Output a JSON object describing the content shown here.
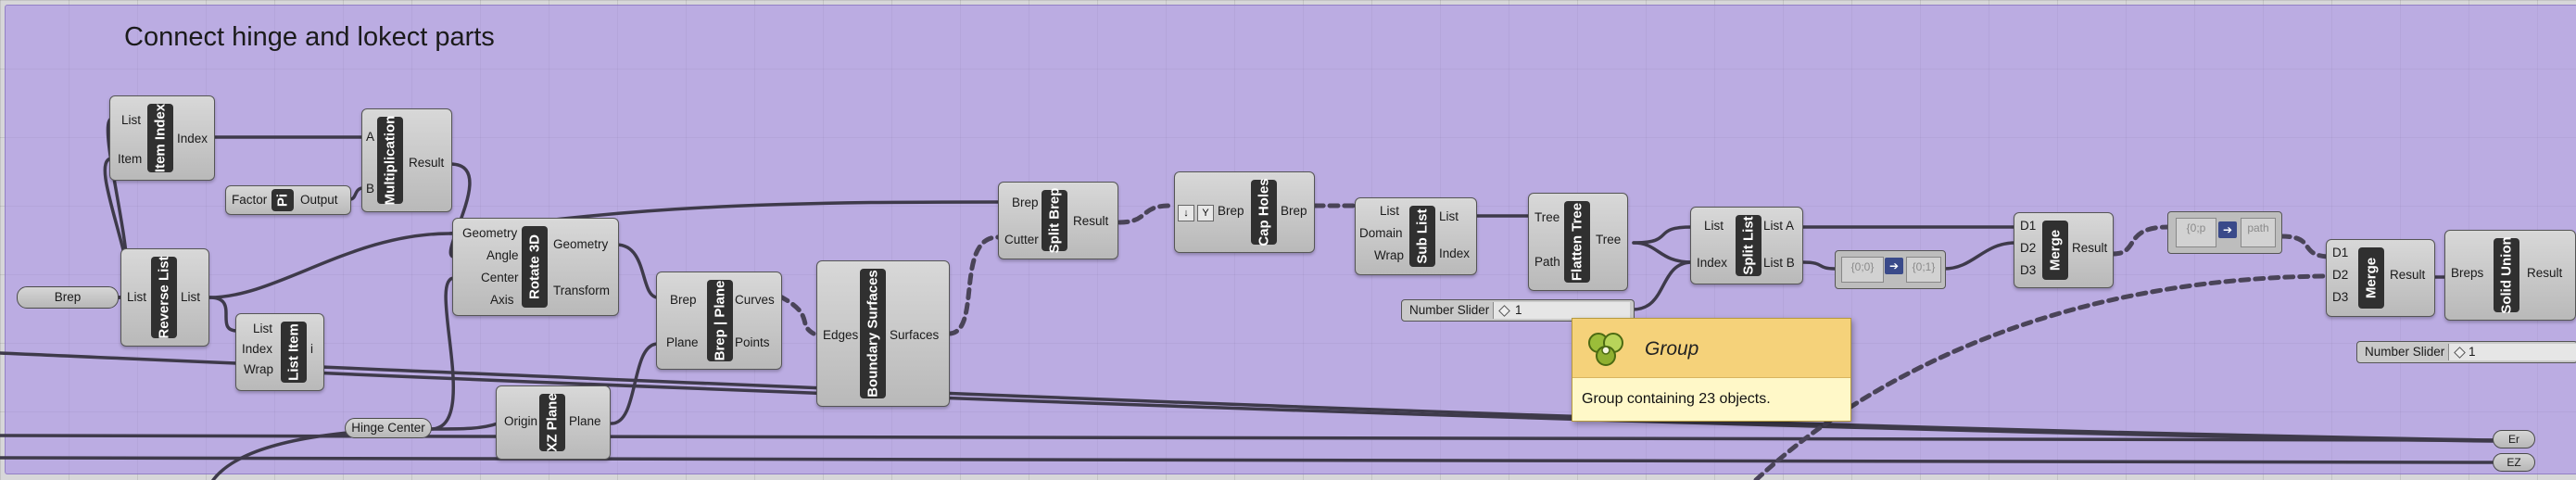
{
  "group": {
    "title": "Connect hinge and lokect parts"
  },
  "components": {
    "item_index": {
      "name": "Item Index",
      "inputs": [
        "List",
        "Item"
      ],
      "outputs": [
        "Index"
      ]
    },
    "multiplication": {
      "name": "Multiplication",
      "inputs": [
        "A",
        "B"
      ],
      "outputs": [
        "Result"
      ]
    },
    "pi": {
      "name": "Pi",
      "inputs": [
        "Factor"
      ],
      "outputs": [
        "Output"
      ]
    },
    "reverse_list": {
      "name": "Reverse List",
      "inputs": [
        "List"
      ],
      "outputs": [
        "List"
      ]
    },
    "list_item": {
      "name": "List Item",
      "inputs": [
        "List",
        "Index",
        "Wrap"
      ],
      "outputs": [
        "i"
      ]
    },
    "rotate_3d": {
      "name": "Rotate 3D",
      "inputs": [
        "Geometry",
        "Angle",
        "Center",
        "Axis"
      ],
      "outputs": [
        "Geometry",
        "Transform"
      ]
    },
    "brep_plane": {
      "name": "Brep | Plane",
      "inputs": [
        "Brep",
        "Plane"
      ],
      "outputs": [
        "Curves",
        "Points"
      ]
    },
    "xz_plane": {
      "name": "XZ Plane",
      "inputs": [
        "Origin"
      ],
      "outputs": [
        "Plane"
      ]
    },
    "boundary_surfaces": {
      "name": "Boundary Surfaces",
      "inputs": [
        "Edges"
      ],
      "outputs": [
        "Surfaces"
      ]
    },
    "split_brep": {
      "name": "Split Brep",
      "inputs": [
        "Brep",
        "Cutter"
      ],
      "outputs": [
        "Result"
      ]
    },
    "cap_holes": {
      "name": "Cap Holes",
      "inputs": [
        "Brep"
      ],
      "outputs": [
        "Brep"
      ]
    },
    "sub_list": {
      "name": "Sub List",
      "inputs": [
        "List",
        "Domain",
        "Wrap"
      ],
      "outputs": [
        "List",
        "Index"
      ]
    },
    "flatten_tree": {
      "name": "Flatten Tree",
      "inputs": [
        "Tree",
        "Path"
      ],
      "outputs": [
        "Tree"
      ]
    },
    "split_list": {
      "name": "Split List",
      "inputs": [
        "List",
        "Index"
      ],
      "outputs": [
        "List A",
        "List B"
      ]
    },
    "merge_1": {
      "name": "Merge",
      "inputs": [
        "D1",
        "D2",
        "D3"
      ],
      "outputs": [
        "Result"
      ]
    },
    "merge_2": {
      "name": "Merge",
      "inputs": [
        "D1",
        "D2",
        "D3"
      ],
      "outputs": [
        "Result"
      ]
    },
    "solid_union": {
      "name": "Solid Union",
      "inputs": [
        "Breps"
      ],
      "outputs": [
        "Result"
      ]
    }
  },
  "params": {
    "brep": "Brep",
    "hinge_center": "Hinge Center",
    "er": "Er",
    "ez": "EZ"
  },
  "sliders": [
    {
      "label": "Number Slider",
      "value": "1"
    },
    {
      "label": "Number Slider",
      "value": "1"
    }
  ],
  "panels": {
    "domain_panel": {
      "left": "{0;0}",
      "right": "{0;1}"
    },
    "path_panel": {
      "left": "{0;p",
      "right": "path"
    }
  },
  "tooltip": {
    "title": "Group",
    "body": "Group containing 23 objects."
  },
  "colors": {
    "group_fill": "#b7a4ea",
    "canvas": "#d7d7d9",
    "component": "#c9c9c9",
    "tooltip_head": "#f5d27a"
  }
}
